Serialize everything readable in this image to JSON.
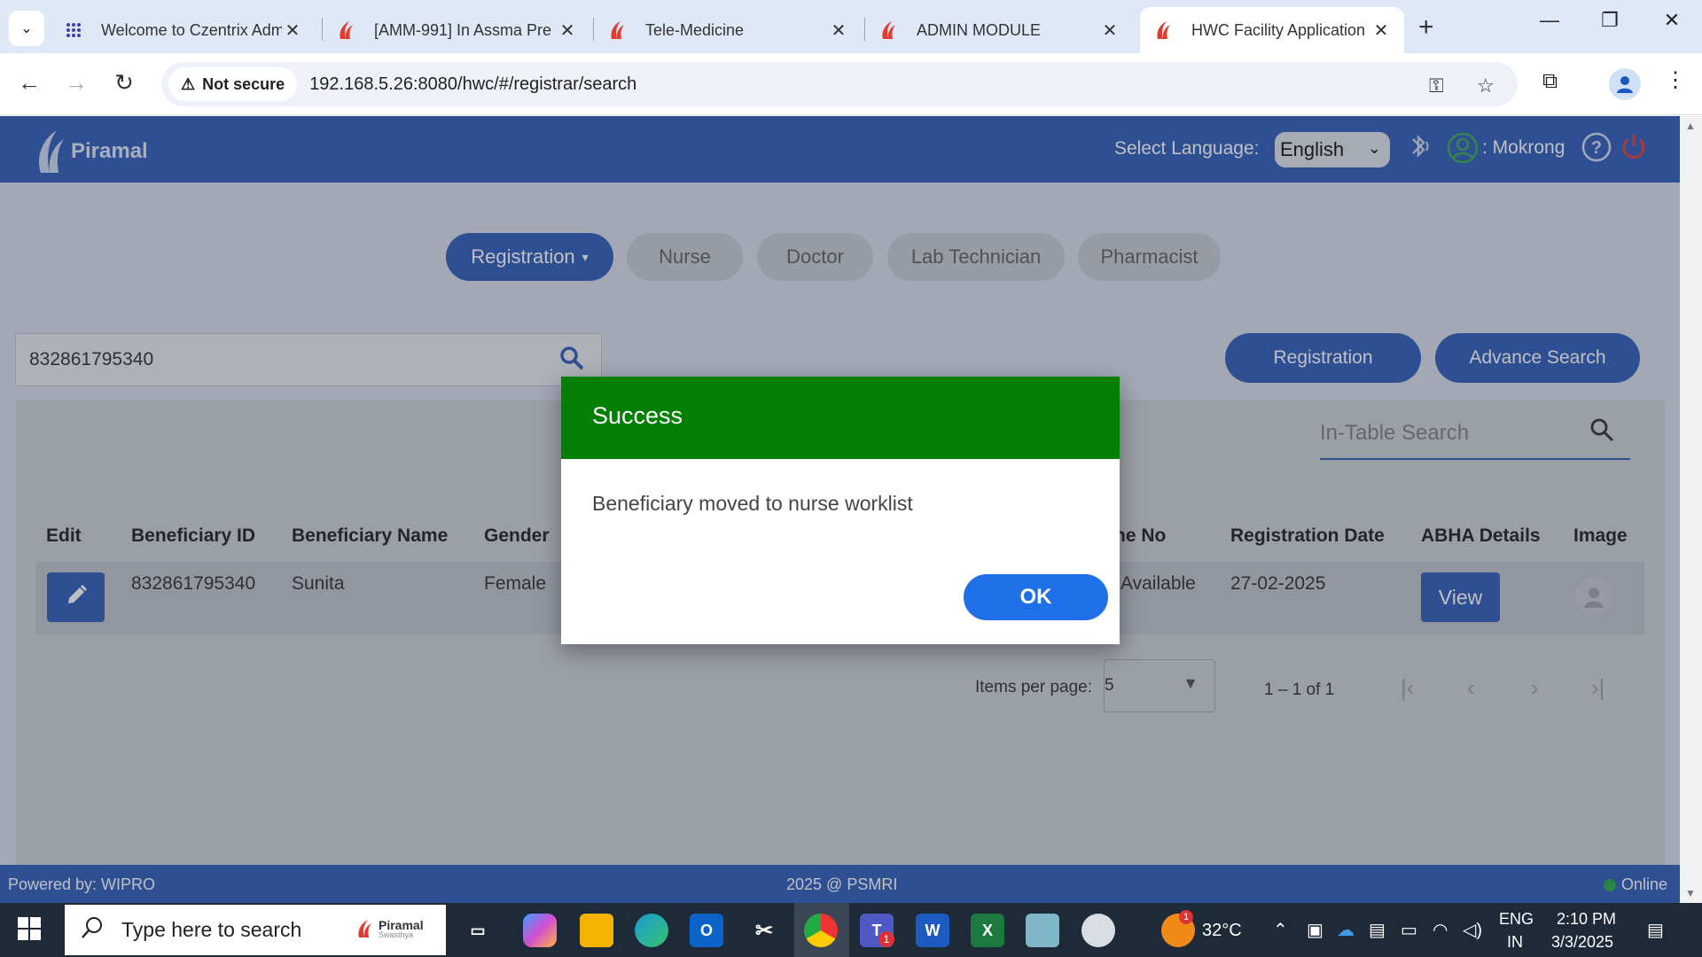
{
  "browser": {
    "tabs": [
      {
        "title": "Welcome to Czentrix Adm",
        "icon": "grid-icon"
      },
      {
        "title": "[AMM-991] In Assma Pre",
        "icon": "piramal-icon"
      },
      {
        "title": "Tele-Medicine",
        "icon": "piramal-icon"
      },
      {
        "title": "ADMIN MODULE",
        "icon": "piramal-icon"
      },
      {
        "title": "HWC Facility Application",
        "icon": "piramal-icon",
        "active": true
      }
    ],
    "security_label": "Not secure",
    "url": "192.168.5.26:8080/hwc/#/registrar/search"
  },
  "header": {
    "brand": "Piramal",
    "language_label": "Select Language:",
    "language_value": "English",
    "username": ": Mokrong"
  },
  "role_tabs": [
    {
      "label": "Registration",
      "active": true
    },
    {
      "label": "Nurse"
    },
    {
      "label": "Doctor"
    },
    {
      "label": "Lab Technician"
    },
    {
      "label": "Pharmacist"
    }
  ],
  "search": {
    "value": "832861795340"
  },
  "actions": {
    "registration": "Registration",
    "advance_search": "Advance Search"
  },
  "in_table_search": {
    "placeholder": "In-Table Search"
  },
  "table": {
    "headers": {
      "edit": "Edit",
      "beneficiary_id": "Beneficiary ID",
      "beneficiary_name": "Beneficiary Name",
      "gender": "Gender",
      "phone_no": "ne No",
      "registration_date": "Registration Date",
      "abha": "ABHA Details",
      "image": "Image"
    },
    "rows": [
      {
        "beneficiary_id": "832861795340",
        "beneficiary_name": "Sunita",
        "gender": "Female",
        "phone_no": "Available",
        "registration_date": "27-02-2025",
        "abha_button": "View"
      }
    ]
  },
  "pagination": {
    "items_per_page_label": "Items per page:",
    "items_per_page_value": "5",
    "range": "1 – 1 of 1"
  },
  "footer": {
    "left": "Powered by: WIPRO",
    "center": "2025 @ PSMRI",
    "status": "Online"
  },
  "dialog": {
    "title": "Success",
    "message": "Beneficiary moved to nurse worklist",
    "ok_label": "OK",
    "header_color": "#038003"
  },
  "taskbar": {
    "search_placeholder": "Type here to search",
    "pinned_label": "Piramal",
    "pinned_sub": "Swasthya",
    "teams_badge": "1",
    "weather_badge": "1",
    "temperature": "32°C",
    "lang_line1": "ENG",
    "lang_line2": "IN",
    "time": "2:10 PM",
    "date": "3/3/2025"
  },
  "colors": {
    "app_blue": "#2353b4",
    "ok_blue": "#1f6fe8",
    "success_green": "#038003"
  }
}
